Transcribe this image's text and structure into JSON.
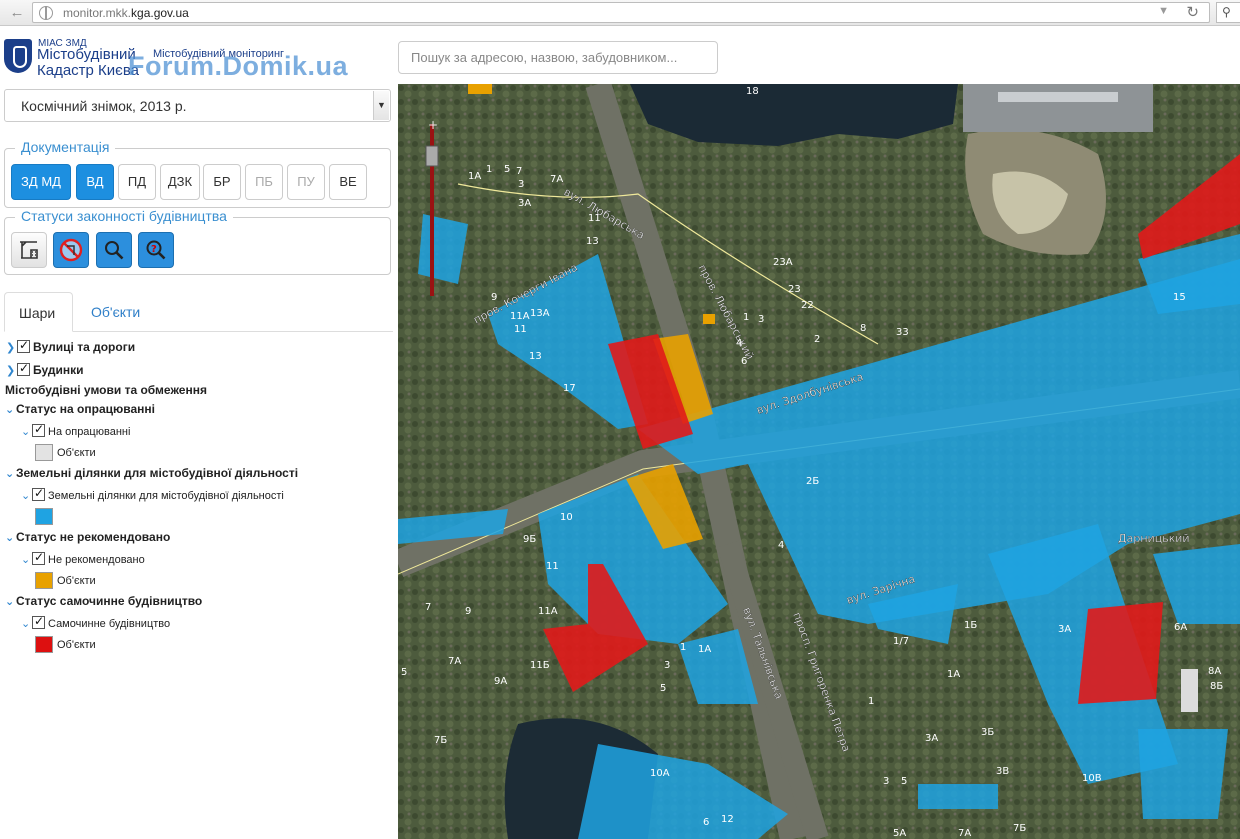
{
  "browser": {
    "url_prefix": "monitor.mkk.",
    "url_domain": "kga.gov.ua",
    "dropdown_icon": "chevron-down-icon",
    "reload_icon": "reload-icon"
  },
  "header": {
    "org_small": "МІАС ЗМД",
    "org_line1": "Містобудівний",
    "org_line2": "Кадастр Києва",
    "app_title": "Містобудівний моніторинг",
    "watermark": "Forum.Domik.ua",
    "search_placeholder": "Пошук за адресою, назвою, забудовником..."
  },
  "sidebar": {
    "basemap_select": "Космічний знімок, 2013 р.",
    "documentation": {
      "legend": "Документація",
      "buttons": [
        {
          "label": "ЗД МД",
          "state": "active"
        },
        {
          "label": "ВД",
          "state": "active"
        },
        {
          "label": "ПД",
          "state": "normal"
        },
        {
          "label": "ДЗК",
          "state": "normal"
        },
        {
          "label": "БР",
          "state": "normal"
        },
        {
          "label": "ПБ",
          "state": "disabled"
        },
        {
          "label": "ПУ",
          "state": "disabled"
        },
        {
          "label": "ВЕ",
          "state": "normal"
        }
      ]
    },
    "legality": {
      "legend": "Статуси законності будівництва",
      "icons": [
        "crane-icon",
        "no-construction-icon",
        "search-icon",
        "question-search-icon"
      ]
    },
    "tabs": [
      "Шари",
      "Об'єкти"
    ],
    "tree": {
      "streets": "Вулиці та дороги",
      "buildings": "Будинки",
      "conditions_header": "Містобудівні умови та обмеження",
      "status_processing": "Статус на опрацюванні",
      "processing_item": "На опрацюванні",
      "objects_label": "Об'єкти",
      "land_plots_header": "Земельні ділянки для містобудівної діяльності",
      "land_plots_item": "Земельні ділянки для містобудівної діяльності",
      "not_recommended_header": "Статус не рекомендовано",
      "not_recommended_item": "Не рекомендовано",
      "unauthorized_header": "Статус самочинне будівництво",
      "unauthorized_item": "Самочинне будівництво"
    },
    "colors": {
      "processing": "#e3e3e3",
      "land": "#1fa3e2",
      "not_recommended": "#e8a100",
      "unauthorized": "#dd1010"
    }
  },
  "map": {
    "street_labels": [
      "вул. Любарська",
      "пров. Кочерги Івана",
      "пров. Любарський",
      "вул. Здолбунівська",
      "вул. Тальнівська",
      "просп. Григоренка Петра",
      "Дарницький",
      "вул. Зарічна"
    ],
    "numbers": [
      "18",
      "1А",
      "1",
      "5",
      "7",
      "7А",
      "3",
      "3А",
      "11",
      "13",
      "9",
      "11А",
      "11",
      "13А",
      "13",
      "17",
      "23А",
      "23",
      "22",
      "2",
      "1",
      "3",
      "4",
      "6",
      "8",
      "33",
      "15",
      "2Б",
      "10",
      "9Б",
      "11",
      "11А",
      "7",
      "9",
      "7А",
      "11Б",
      "9А",
      "5",
      "7Б",
      "3",
      "1А",
      "1",
      "5",
      "1/7",
      "1Б",
      "1А",
      "1",
      "3А",
      "3Б",
      "3В",
      "3",
      "5",
      "5А",
      "7А",
      "7Б",
      "10В",
      "3А",
      "6А",
      "8А",
      "8Б",
      "10А",
      "6",
      "12",
      "4"
    ]
  }
}
